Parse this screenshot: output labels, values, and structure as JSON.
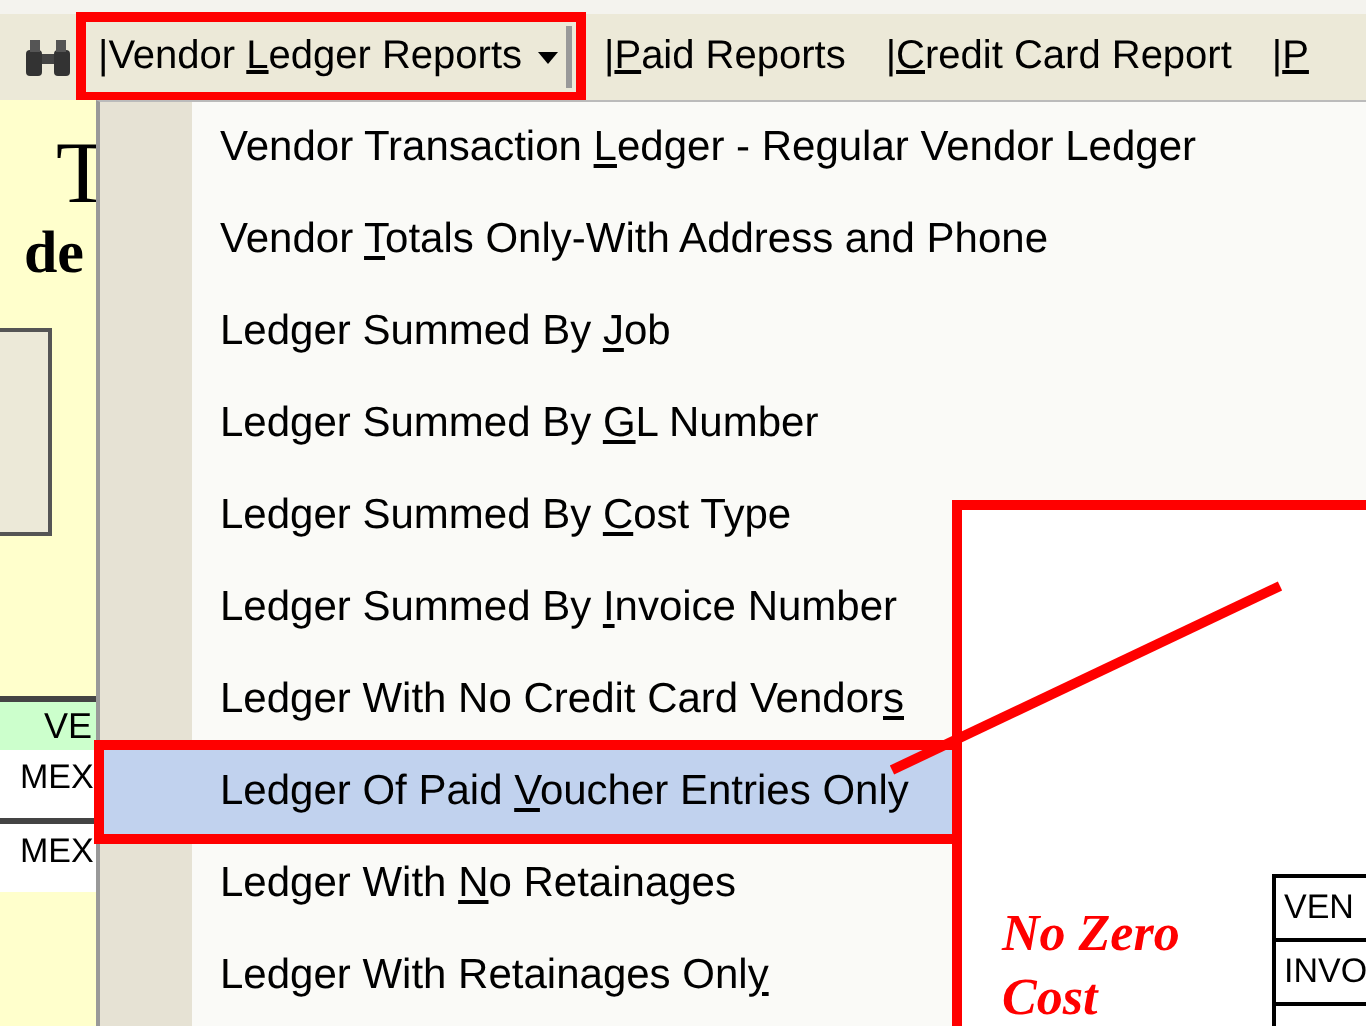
{
  "toolbar": {
    "menus": [
      {
        "pre": "|Vendor ",
        "key": "L",
        "post": "edger Reports",
        "dropdown": true,
        "annotated": true
      },
      {
        "pre": "|",
        "key": "P",
        "post": "aid Reports",
        "dropdown": false,
        "annotated": false
      },
      {
        "pre": "|",
        "key": "C",
        "post": "redit Card Report",
        "dropdown": false,
        "annotated": false
      },
      {
        "pre": "|",
        "key": "P",
        "dropdown": false,
        "annotated": false
      }
    ]
  },
  "background": {
    "heading_1": "T",
    "heading_2": "de",
    "band_label": "VE",
    "rows": [
      "MEX",
      "MEX"
    ]
  },
  "menu": {
    "items": [
      {
        "pre": "Vendor Transaction ",
        "key": "L",
        "post": "edger - Regular Vendor Ledger",
        "selected": false,
        "annotated": false
      },
      {
        "pre": "Vendor ",
        "key": "T",
        "post": "otals Only-With Address and Phone",
        "selected": false,
        "annotated": false
      },
      {
        "pre": "Ledger Summed By ",
        "key": "J",
        "post": "ob",
        "selected": false,
        "annotated": false
      },
      {
        "pre": "Ledger Summed By ",
        "key": "G",
        "post": "L Number",
        "selected": false,
        "annotated": false
      },
      {
        "pre": "Ledger Summed By ",
        "key": "C",
        "post": "ost Type",
        "selected": false,
        "annotated": false
      },
      {
        "pre": "Ledger Summed By ",
        "key": "I",
        "post": "nvoice Number",
        "selected": false,
        "annotated": false
      },
      {
        "pre": "Ledger With No Credit Card Vendor",
        "key": "s",
        "selected": false,
        "annotated": false
      },
      {
        "pre": "Ledger Of Paid ",
        "key": "V",
        "post": "oucher Entries Only",
        "selected": true,
        "annotated": true
      },
      {
        "pre": "Ledger With ",
        "key": "N",
        "post": "o Retainages",
        "selected": false,
        "annotated": false
      },
      {
        "pre": "Ledger With Retainages Onl",
        "key": "y",
        "selected": false,
        "annotated": false
      }
    ]
  },
  "callout": {
    "note": "No Zero Cost",
    "table_rows": [
      "VEN",
      "INVO"
    ]
  }
}
